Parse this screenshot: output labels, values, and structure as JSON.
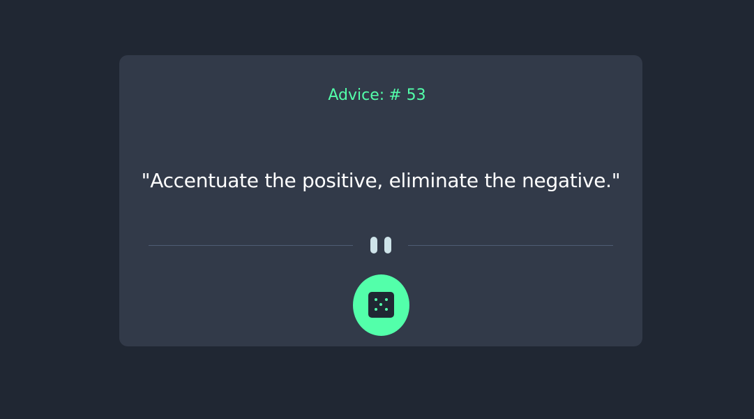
{
  "advice": {
    "label": "Advice:",
    "number": "# 53",
    "quote": "\"Accentuate the positive, eliminate the negative.\""
  },
  "divider": {
    "icon": "pause-icon"
  },
  "generate_button": {
    "icon": "dice-icon"
  },
  "colors": {
    "background": "#202733",
    "card": "#323a49",
    "accent": "#53ffaa",
    "text": "#ffffff",
    "divider": "#4f5d74",
    "pause": "#cee3e9"
  }
}
